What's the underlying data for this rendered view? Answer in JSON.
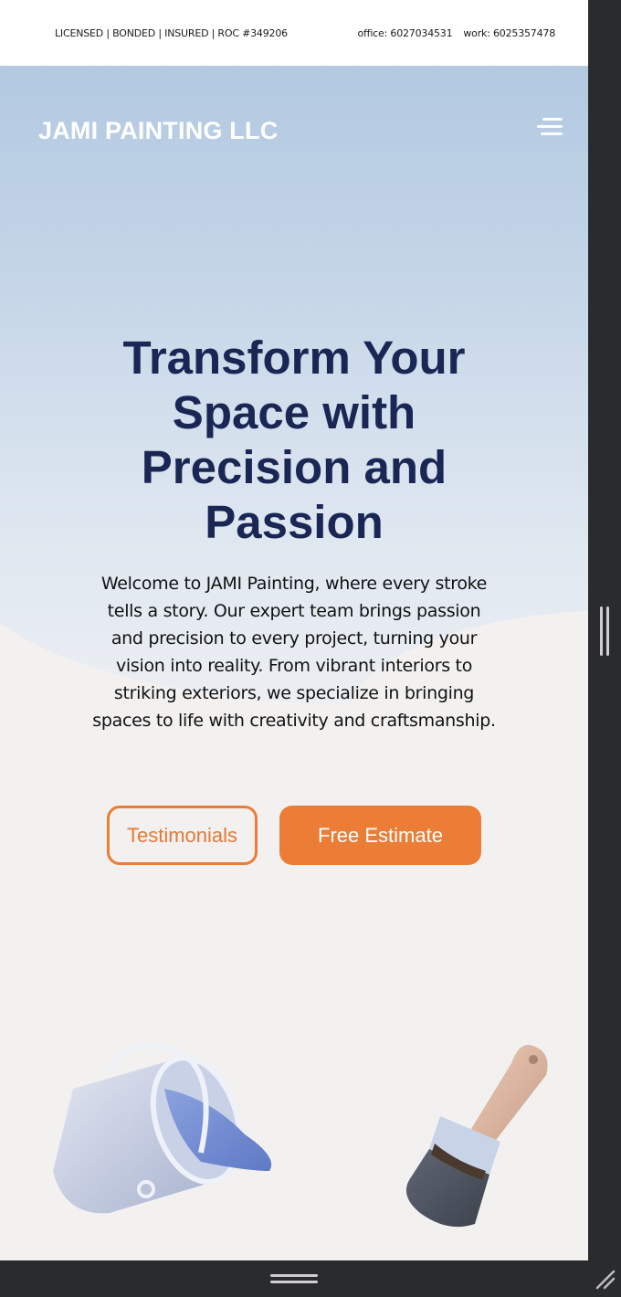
{
  "topbar": {
    "credentials": "LICENSED | BONDED | INSURED | ROC #349206",
    "office": "office: 6027034531",
    "work": "work: 6025357478"
  },
  "header": {
    "brand": "JAMI PAINTING LLC",
    "menu_icon": "hamburger-menu-icon"
  },
  "hero": {
    "headline": "Transform Your Space with Precision and Passion",
    "intro": "Welcome to JAMI Painting, where every stroke tells a story. Our expert team brings passion and precision to every project, turning your vision into reality. From vibrant interiors to striking exteriors, we specialize in bringing spaces to life with creativity and craftsmanship.",
    "buttons": {
      "testimonials": "Testimonials",
      "estimate": "Free Estimate"
    },
    "illustrations": [
      "paint-bucket-illustration",
      "paint-brush-illustration"
    ]
  },
  "colors": {
    "accent": "#ec7d36",
    "headline": "#1a2755",
    "sky_top": "#b2c9e1",
    "background": "#f2f1f0"
  }
}
